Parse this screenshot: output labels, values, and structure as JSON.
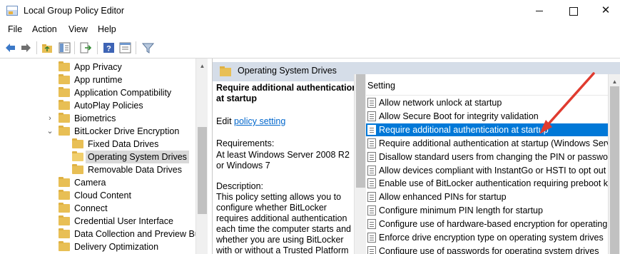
{
  "window": {
    "title": "Local Group Policy Editor",
    "minimize": "—",
    "maximize": "□",
    "close": "✕"
  },
  "menu": [
    "File",
    "Action",
    "View",
    "Help"
  ],
  "toolbar": {
    "buttons": [
      "back-icon",
      "forward-icon",
      "up-folder-icon",
      "show-hide-tree-icon",
      "export-list-icon",
      "help-icon",
      "properties-icon",
      "filter-icon"
    ]
  },
  "tree": [
    {
      "label": "App Privacy",
      "level": 1,
      "expander": "",
      "selected": false
    },
    {
      "label": "App runtime",
      "level": 1,
      "expander": "",
      "selected": false
    },
    {
      "label": "Application Compatibility",
      "level": 1,
      "expander": "",
      "selected": false
    },
    {
      "label": "AutoPlay Policies",
      "level": 1,
      "expander": "",
      "selected": false
    },
    {
      "label": "Biometrics",
      "level": 1,
      "expander": "›",
      "selected": false
    },
    {
      "label": "BitLocker Drive Encryption",
      "level": 1,
      "expander": "⌄",
      "selected": false
    },
    {
      "label": "Fixed Data Drives",
      "level": 2,
      "expander": "",
      "selected": false
    },
    {
      "label": "Operating System Drives",
      "level": 2,
      "expander": "",
      "selected": true
    },
    {
      "label": "Removable Data Drives",
      "level": 2,
      "expander": "",
      "selected": false
    },
    {
      "label": "Camera",
      "level": 1,
      "expander": "",
      "selected": false
    },
    {
      "label": "Cloud Content",
      "level": 1,
      "expander": "",
      "selected": false
    },
    {
      "label": "Connect",
      "level": 1,
      "expander": "",
      "selected": false
    },
    {
      "label": "Credential User Interface",
      "level": 1,
      "expander": "",
      "selected": false
    },
    {
      "label": "Data Collection and Preview Buil",
      "level": 1,
      "expander": "",
      "selected": false
    },
    {
      "label": "Delivery Optimization",
      "level": 1,
      "expander": "",
      "selected": false
    }
  ],
  "header": {
    "title": "Operating System Drives"
  },
  "description": {
    "title": "Require additional authentication at startup",
    "edit_prefix": "Edit",
    "edit_link": "policy setting",
    "requirements_label": "Requirements:",
    "requirements": "At least Windows Server 2008 R2 or Windows 7",
    "description_label": "Description:",
    "description_text": "This policy setting allows you to configure whether BitLocker requires additional authentication each time the computer starts and whether you are using BitLocker with or without a Trusted Platform"
  },
  "list": {
    "column_header": "Setting",
    "rows": [
      "Allow network unlock at startup",
      "Allow Secure Boot for integrity validation",
      "Require additional authentication at startup",
      "Require additional authentication at startup (Windows Serve...",
      "Disallow standard users from changing the PIN or password",
      "Allow devices compliant with InstantGo or HSTI to opt out o...",
      "Enable use of BitLocker authentication requiring preboot ke...",
      "Allow enhanced PINs for startup",
      "Configure minimum PIN length for startup",
      "Configure use of hardware-based encryption for operating s...",
      "Enforce drive encryption type on operating system drives",
      "Configure use of passwords for operating system drives"
    ],
    "selected_index": 2
  },
  "colors": {
    "selection": "#0078d7",
    "header_band": "#d5dde8",
    "annotation_arrow": "#e03b2f",
    "link": "#0066cc"
  }
}
